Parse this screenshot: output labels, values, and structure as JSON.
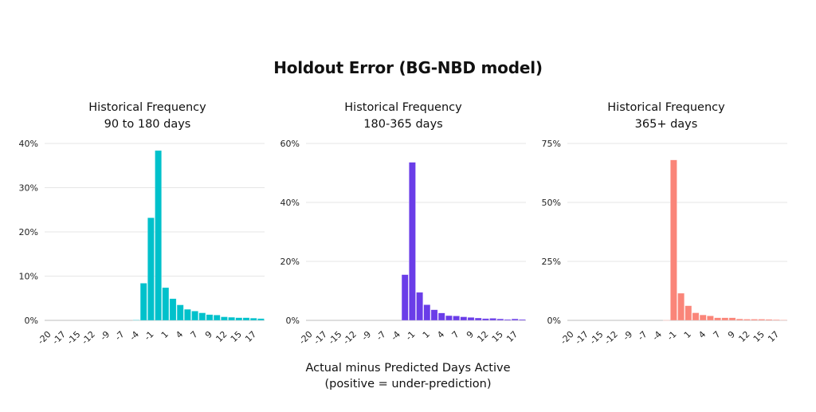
{
  "title": "Holdout Error (BG-NBD model)",
  "footer": {
    "line1": "Actual minus Predicted Days Active",
    "line2": "(positive = under-prediction)"
  },
  "chart_data": [
    {
      "type": "bar",
      "title_line1": "Historical Frequency",
      "title_line2": "90 to 180 days",
      "color": "#00C1CB",
      "xlabel": "Actual minus Predicted Days Active (positive = under-prediction)",
      "ylabel": "",
      "ylim": [
        0,
        40
      ],
      "yticks": [
        0,
        10,
        20,
        30,
        40
      ],
      "ytick_labels": [
        "0%",
        "10%",
        "20%",
        "30%",
        "40%"
      ],
      "xtick_labels": [
        "-20",
        "-17",
        "-15",
        "-12",
        "-9",
        "-7",
        "-4",
        "-1",
        "1",
        "4",
        "7",
        "9",
        "12",
        "15",
        "17"
      ],
      "bin_count": 30,
      "grid": true,
      "values": [
        0,
        0,
        0,
        0,
        0,
        0,
        0,
        0,
        0,
        0,
        0,
        0,
        0.1,
        8.4,
        23.2,
        38.4,
        7.4,
        4.9,
        3.5,
        2.5,
        2.1,
        1.7,
        1.3,
        1.2,
        0.8,
        0.7,
        0.6,
        0.6,
        0.5,
        0.4
      ]
    },
    {
      "type": "bar",
      "title_line1": "Historical Frequency",
      "title_line2": "180-365 days",
      "color": "#6A3DE8",
      "xlabel": "Actual minus Predicted Days Active (positive = under-prediction)",
      "ylabel": "",
      "ylim": [
        0,
        60
      ],
      "yticks": [
        0,
        20,
        40,
        60
      ],
      "ytick_labels": [
        "0%",
        "20%",
        "40%",
        "60%"
      ],
      "xtick_labels": [
        "-20",
        "-17",
        "-15",
        "-12",
        "-9",
        "-7",
        "-4",
        "-1",
        "1",
        "4",
        "7",
        "9",
        "12",
        "15",
        "17"
      ],
      "bin_count": 30,
      "grid": true,
      "values": [
        0,
        0,
        0,
        0,
        0,
        0,
        0,
        0,
        0,
        0,
        0,
        0,
        0,
        15.5,
        53.6,
        9.5,
        5.3,
        3.6,
        2.5,
        1.6,
        1.5,
        1.2,
        1.0,
        0.8,
        0.6,
        0.7,
        0.5,
        0.3,
        0.5,
        0.3
      ]
    },
    {
      "type": "bar",
      "title_line1": "Historical Frequency",
      "title_line2": "365+ days",
      "color": "#FA8579",
      "xlabel": "Actual minus Predicted Days Active (positive = under-prediction)",
      "ylabel": "",
      "ylim": [
        0,
        75
      ],
      "yticks": [
        0,
        25,
        50,
        75
      ],
      "ytick_labels": [
        "0%",
        "25%",
        "50%",
        "75%"
      ],
      "xtick_labels": [
        "-20",
        "-17",
        "-15",
        "-12",
        "-9",
        "-7",
        "-4",
        "-1",
        "1",
        "4",
        "7",
        "9",
        "12",
        "15",
        "17"
      ],
      "bin_count": 30,
      "grid": true,
      "values": [
        0,
        0,
        0,
        0,
        0,
        0,
        0,
        0,
        0,
        0,
        0,
        0,
        0,
        0.1,
        68.0,
        11.5,
        6.2,
        3.2,
        2.3,
        1.9,
        1.1,
        1.1,
        1.1,
        0.6,
        0.5,
        0.5,
        0.5,
        0.4,
        0.3,
        0.2
      ]
    }
  ]
}
